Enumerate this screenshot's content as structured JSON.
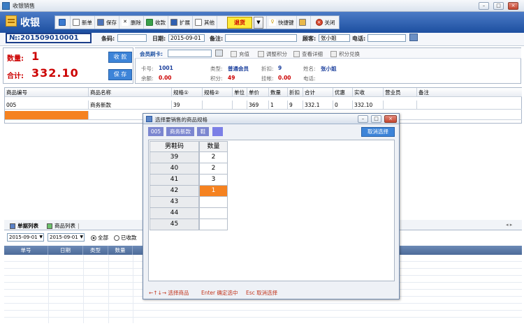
{
  "window": {
    "title": "收银销售"
  },
  "header": {
    "logo_text": "收银"
  },
  "toolbar": {
    "items": [
      {
        "label": "",
        "icon": "book-icon"
      },
      {
        "label": "新单",
        "icon": "new-doc-icon"
      },
      {
        "label": "保存",
        "icon": "floppy-icon"
      },
      {
        "label": "删除",
        "icon": "x-icon"
      },
      {
        "label": "收款",
        "icon": "money-icon"
      },
      {
        "label": "扩展",
        "icon": "list-icon"
      },
      {
        "label": "其他",
        "icon": "doc-icon"
      }
    ],
    "return_label": "退货",
    "shortcut_label": "快捷键",
    "close_label": "关闭"
  },
  "order": {
    "number": "№:201509010001",
    "barcode_label": "条码:",
    "barcode_value": "",
    "date_label": "日期:",
    "date_value": "2015-09-01",
    "note_label": "备注:",
    "note_value": "",
    "customer_label": "顾客:",
    "customer_value": "张小姐",
    "phone_label": "电话:",
    "phone_value": ""
  },
  "summary": {
    "qty_label": "数量:",
    "qty_value": "1",
    "total_label": "合计:",
    "total_value": "332.10",
    "collect_btn": "收 款",
    "save_btn": "保 存"
  },
  "member": {
    "card_label": "会员刷卡:",
    "card_value": "",
    "actions": [
      "充值",
      "调整积分",
      "查看详细",
      "积分兑换"
    ],
    "card_no_label": "卡号:",
    "card_no": "1001",
    "type_label": "类型:",
    "type": "普通会员",
    "discount_label": "折扣:",
    "discount": "9",
    "name_label": "姓名:",
    "name": "张小姐",
    "balance_label": "余额:",
    "balance": "0.00",
    "points_label": "积分:",
    "points": "49",
    "credit_label": "挂帐:",
    "credit": "0.00",
    "phone_label": "电话:",
    "phone": ""
  },
  "grid": {
    "columns": [
      "商品编号",
      "商品名称",
      "规格①",
      "规格②",
      "单位",
      "单价",
      "数量",
      "折扣",
      "合计",
      "优惠",
      "实收",
      "营业员",
      "备注"
    ],
    "rows": [
      [
        "005",
        "商务新款",
        "39",
        "",
        "",
        "369",
        "1",
        "9",
        "332.1",
        "0",
        "332.10",
        "",
        ""
      ]
    ]
  },
  "lower": {
    "tabs": [
      "单据列表",
      "商品列表"
    ],
    "date_from": "2015-09-01",
    "date_to": "2015-09-01",
    "radio_all": "全部",
    "radio_paid": "已收款",
    "columns": [
      "单号",
      "日期",
      "类型",
      "数量"
    ]
  },
  "dialog": {
    "title": "选择要销售的商品规格",
    "chips": [
      "005",
      "商务新款",
      "鞋",
      ""
    ],
    "cancel_label": "取消选择",
    "size_header": "男鞋码",
    "qty_header": "数量",
    "rows": [
      {
        "size": "39",
        "qty": "2"
      },
      {
        "size": "40",
        "qty": "2"
      },
      {
        "size": "41",
        "qty": "3"
      },
      {
        "size": "42",
        "qty": "1"
      },
      {
        "size": "43",
        "qty": ""
      },
      {
        "size": "44",
        "qty": ""
      },
      {
        "size": "45",
        "qty": ""
      }
    ],
    "selected_index": 3,
    "hint1": "←↑↓→ 选择商品",
    "hint2": "Enter 确定选中",
    "hint3": "Esc 取消选择"
  },
  "colors": {
    "accent": "#1d4fa0",
    "selection": "#f58220",
    "warning": "#ffea3a",
    "button": "#3d84d8"
  }
}
